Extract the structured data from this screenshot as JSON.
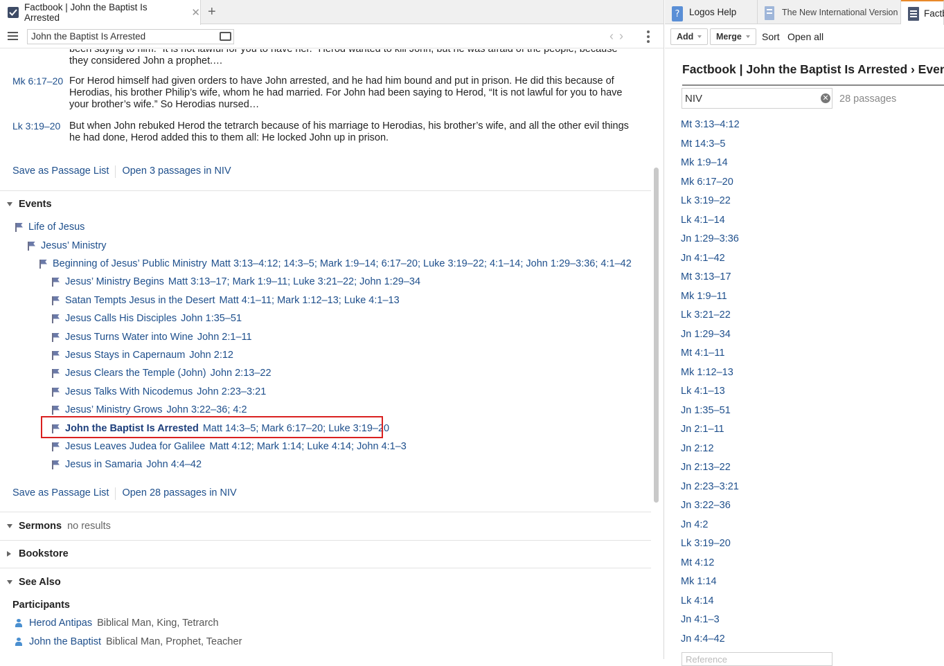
{
  "left_tab": {
    "title": "Factbook | John the Baptist Is Arrested"
  },
  "right_tabs": [
    {
      "label": "Logos Help"
    },
    {
      "label": "The New International Version"
    },
    {
      "label": "Factb"
    }
  ],
  "toolbar": {
    "address": "John the Baptist Is Arrested"
  },
  "passages": [
    {
      "ref": "",
      "text": "been saying to him: “It is not lawful for you to have her.” Herod wanted to kill John, but he was afraid of the people, because they considered John a prophet.…"
    },
    {
      "ref": "Mk 6:17–20",
      "text": "For Herod himself had given orders to have John arrested, and he had him bound and put in prison. He did this because of Herodias, his brother Philip’s wife, whom he had married. For John had been saying to Herod, “It is not lawful for you to have your brother’s wife.” So Herodias nursed…"
    },
    {
      "ref": "Lk 3:19–20",
      "text": "But when John rebuked Herod the tetrarch because of his marriage to Herodias, his brother’s wife, and all the other evil things he had done, Herod added this to them all: He locked John up in prison."
    }
  ],
  "passage_actions": {
    "save": "Save as Passage List",
    "open": "Open 3 passages in NIV"
  },
  "events": {
    "heading": "Events",
    "items": [
      {
        "title": "Life of Jesus",
        "refs": ""
      },
      {
        "title": "Jesus’ Ministry",
        "refs": ""
      },
      {
        "title": "Beginning of Jesus’ Public Ministry",
        "refs": "Matt 3:13–4:12; 14:3–5; Mark 1:9–14; 6:17–20; Luke 3:19–22; 4:1–14; John 1:29–3:36; 4:1–42"
      },
      {
        "title": "Jesus’ Ministry Begins",
        "refs": "Matt 3:13–17; Mark 1:9–11; Luke 3:21–22; John 1:29–34"
      },
      {
        "title": "Satan Tempts Jesus in the Desert",
        "refs": "Matt 4:1–11; Mark 1:12–13; Luke 4:1–13"
      },
      {
        "title": "Jesus Calls His Disciples",
        "refs": "John 1:35–51"
      },
      {
        "title": "Jesus Turns Water into Wine",
        "refs": "John 2:1–11"
      },
      {
        "title": "Jesus Stays in Capernaum",
        "refs": "John 2:12"
      },
      {
        "title": "Jesus Clears the Temple (John)",
        "refs": "John 2:13–22"
      },
      {
        "title": "Jesus Talks With Nicodemus",
        "refs": "John 2:23–3:21"
      },
      {
        "title": "Jesus’ Ministry Grows",
        "refs": "John 3:22–36; 4:2"
      },
      {
        "title": "John the Baptist Is Arrested",
        "refs": "Matt 14:3–5; Mark 6:17–20; Luke 3:19–20"
      },
      {
        "title": "Jesus Leaves Judea for Galilee",
        "refs": "Matt 4:12; Mark 1:14; Luke 4:14; John 4:1–3"
      },
      {
        "title": "Jesus in Samaria",
        "refs": "John 4:4–42"
      }
    ],
    "save": "Save as Passage List",
    "open": "Open 28 passages in NIV"
  },
  "sermons": {
    "heading": "Sermons",
    "status": "no results"
  },
  "bookstore": {
    "heading": "Bookstore"
  },
  "see_also": {
    "heading": "See Also",
    "participants_label": "Participants",
    "participants": [
      {
        "name": "Herod Antipas",
        "type": "Biblical Man, King, Tetrarch"
      },
      {
        "name": "John the Baptist",
        "type": "Biblical Man, Prophet, Teacher"
      }
    ]
  },
  "right_pane": {
    "add": "Add",
    "merge": "Merge",
    "sort": "Sort",
    "open_all": "Open all",
    "heading": "Factbook | John the Baptist Is Arrested › Events",
    "filter_value": "NIV",
    "count": "28 passages",
    "passage_refs": [
      "Mt 3:13–4:12",
      "Mt 14:3–5",
      "Mk 1:9–14",
      "Mk 6:17–20",
      "Lk 3:19–22",
      "Lk 4:1–14",
      "Jn 1:29–3:36",
      "Jn 4:1–42",
      "Mt 3:13–17",
      "Mk 1:9–11",
      "Lk 3:21–22",
      "Jn 1:29–34",
      "Mt 4:1–11",
      "Mk 1:12–13",
      "Lk 4:1–13",
      "Jn 1:35–51",
      "Jn 2:1–11",
      "Jn 2:12",
      "Jn 2:13–22",
      "Jn 2:23–3:21",
      "Jn 3:22–36",
      "Jn 4:2",
      "Lk 3:19–20",
      "Mt 4:12",
      "Mk 1:14",
      "Lk 4:14",
      "Jn 4:1–3",
      "Jn 4:4–42"
    ],
    "reference_placeholder": "Reference"
  }
}
